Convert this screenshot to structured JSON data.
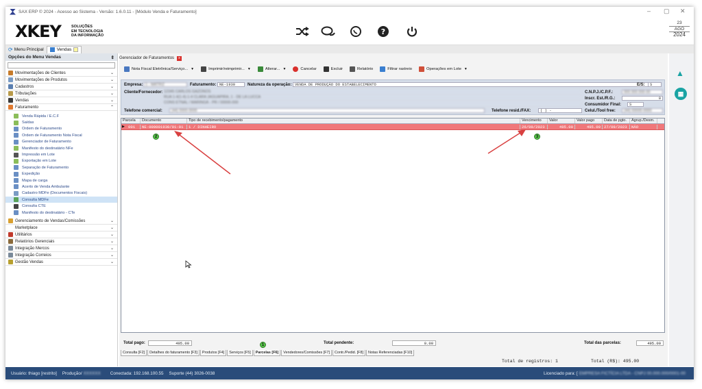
{
  "window": {
    "title": "SAX ERP © 2024 - Acesso ao Sistema - Versão: 1.6.0.11 - [Módulo Venda e Faturamento]",
    "minimize": "–",
    "restore": "▢",
    "close": "✕"
  },
  "brand": {
    "logo": "XKEY",
    "tagline1": "SOLUÇÕES",
    "tagline2": "EM TECNOLOGIA",
    "tagline3": "DA INFORMAÇÃO"
  },
  "header_icons": [
    "shuffle-icon",
    "chat-icon",
    "whatsapp-icon",
    "help-icon",
    "power-icon"
  ],
  "date": {
    "day": "23",
    "month": "AGO",
    "year": "2024"
  },
  "top_tabs": [
    {
      "label": "Menu Principal"
    },
    {
      "label": "Vendas"
    }
  ],
  "left_menu": {
    "title": "Opções do Menu Vendas",
    "groups_top": [
      {
        "label": "Movimentações de Clientes",
        "color": "#c77b2a"
      },
      {
        "label": "Movimentações de Produtos",
        "color": "#7a9bc4"
      },
      {
        "label": "Cadastros",
        "color": "#5a7fb0"
      },
      {
        "label": "Tributações",
        "color": "#b89a4a"
      },
      {
        "label": "Vendas",
        "color": "#3a3a3a"
      },
      {
        "label": "Faturamento",
        "color": "#e07a30"
      }
    ],
    "items": [
      {
        "label": "Venda Rápida / E.C.F",
        "color": "#8bbd5a"
      },
      {
        "label": "Saídas",
        "color": "#8bbd5a"
      },
      {
        "label": "Ordem de Faturamento",
        "color": "#6a8fc4"
      },
      {
        "label": "Ordem de Faturamento Nota Fiscal",
        "color": "#6a8fc4"
      },
      {
        "label": "Gerenciador de Faturamento",
        "color": "#6a8fc4"
      },
      {
        "label": "Manifesto do destinatário NFe",
        "color": "#8bbd5a"
      },
      {
        "label": "Impressão em Lote",
        "color": "#555555"
      },
      {
        "label": "Exportação em Lote",
        "color": "#8bbd5a"
      },
      {
        "label": "Separação de Faturamento",
        "color": "#6a8fc4"
      },
      {
        "label": "Expedição",
        "color": "#6a8fc4"
      },
      {
        "label": "Mapa de carga",
        "color": "#6a8fc4"
      },
      {
        "label": "Acerto de Venda Ambulante",
        "color": "#6a8fc4"
      },
      {
        "label": "Cadastro MDFe (Documentos Fiscais)",
        "color": "#7a9bc4"
      },
      {
        "label": "Consulta MDFe",
        "color": "#5aa35a"
      },
      {
        "label": "Consulta CTE",
        "color": "#444444"
      },
      {
        "label": "Manifesto do destinatário - CTe",
        "color": "#6a8fc4"
      }
    ],
    "groups_bottom": [
      {
        "label": "Gerenciamento de Vendas/Comissões",
        "color": "#d9a030"
      },
      {
        "label": "Marketplace",
        "color": "#ffffff"
      },
      {
        "label": "Utilitários",
        "color": "#c0392b"
      },
      {
        "label": "Relatórios Gerenciais",
        "color": "#8a6a3a"
      },
      {
        "label": "Integração Mercos",
        "color": "#7a8a9a"
      },
      {
        "label": "Integração Correios",
        "color": "#7a8a9a"
      },
      {
        "label": "Gestão Vendas",
        "color": "#b8a030"
      }
    ]
  },
  "main": {
    "tab_title": "Gerenciador de Faturamentos",
    "toolbar": [
      {
        "label": "Nota Fiscal Eletrônica/Serviço...",
        "icon": "nfe-icon",
        "dropdown": true
      },
      {
        "label": "Imprimir/reimprimir...",
        "icon": "printer-icon",
        "dropdown": true
      },
      {
        "label": "Alterar...",
        "icon": "edit-icon",
        "dropdown": true
      },
      {
        "label": "Cancelar",
        "icon": "cancel-icon",
        "dropdown": false
      },
      {
        "label": "Excluir",
        "icon": "trash-icon",
        "dropdown": false
      },
      {
        "label": "Relatório",
        "icon": "report-icon",
        "dropdown": false
      },
      {
        "label": "Filtrar rastreio",
        "icon": "search-icon",
        "dropdown": false
      },
      {
        "label": "Operações em Lote",
        "icon": "batch-icon",
        "dropdown": true
      }
    ],
    "info": {
      "empresa_label": "Empresa:",
      "empresa_value": "1 - MATRIZ",
      "faturamento_label": "Faturamento:",
      "faturamento_value": "NE-1930",
      "natureza_label": "Natureza da operação:",
      "natureza_value": "VENDA DE PRODUÇÃO DO ESTABELECIMENTO",
      "es_label": "E/S:",
      "es_value": "S",
      "cliente_label": "Cliente/Fornecedor:",
      "cliente_line1": "12345 CARLOS GAZONOS",
      "cliente_line2": "RUA 1-4(1-4)-1-4 CLARA JAGUAPIRA, 1 - DE LA LUCCA",
      "cliente_line3": "CONS ETNAL / MARINGÁ - PR / 00000-000",
      "cnpj_label": "C.N.P.J./C.P.F.:",
      "cnpj_value": "000.000.000-00",
      "inscr_label": "Inscr. Est./R.G.:",
      "inscr_value": "0",
      "consumidor_label": "Consumidor Final:",
      "consumidor_value": "S",
      "tel_com_label": "Telefone comercial:",
      "tel_com_value": "(44) 0000-0000",
      "tel_res_label": "Telefone resid./FAX:",
      "tel_res_value": "(  )        -",
      "cel_label": "Celul./Tool free:",
      "cel_value": "(44) 00000-0000"
    },
    "grid": {
      "columns": [
        "Parcela",
        "Documento",
        "Tipo de recebimento/pagamento",
        "Vencimento",
        "Valor",
        "Valor pago",
        "Data de pgto.",
        "Agrup./Desm."
      ],
      "rows": [
        [
          "001",
          "NE-000001930/01-01",
          "1 / DINHEIRO",
          "26/09/2023",
          "495.00",
          "495.00",
          "27/09/2023",
          "NÃO"
        ]
      ]
    },
    "totals": {
      "pago_label": "Total pago:",
      "pago_value": "495.00",
      "pendente_label": "Total pendente:",
      "pendente_value": "0.00",
      "parcelas_label": "Total das parcelas:",
      "parcelas_value": "495.00"
    },
    "bottom_tabs": [
      "Consulta [F2]",
      "Detalhes do faturamento [F3]",
      "Produtos [F4]",
      "Serviços [F5]",
      "Parcelas [F6]",
      "Vendedores/Comissões [F7]",
      "Contr./Pedid. [F8]",
      "Notas Referenciadas [F10]"
    ],
    "active_bottom_tab": 4,
    "registros": "Total de registros: 1",
    "total_rs": "Total (R$): 495.00"
  },
  "annotations": {
    "badge1": "1",
    "badge2": "2",
    "badge3": "3"
  },
  "status": {
    "usuario": "Usuário: thiago [restrito]",
    "producao": "Produção/",
    "conectada": "Conectada: 192.168.100.55",
    "suporte": "Suporte (44) 3026-0038",
    "licenciado": "Licenciado para: [",
    "licenciado_value": "EMPRESA FICTÍCIA LTDA - CNPJ 00.000.000/0001-00"
  },
  "colors": {
    "accent": "#2a4c7a",
    "row_highlight": "#f0777a",
    "teal": "#19a3a3",
    "badge": "#57c24a",
    "arrow": "#d94040"
  }
}
